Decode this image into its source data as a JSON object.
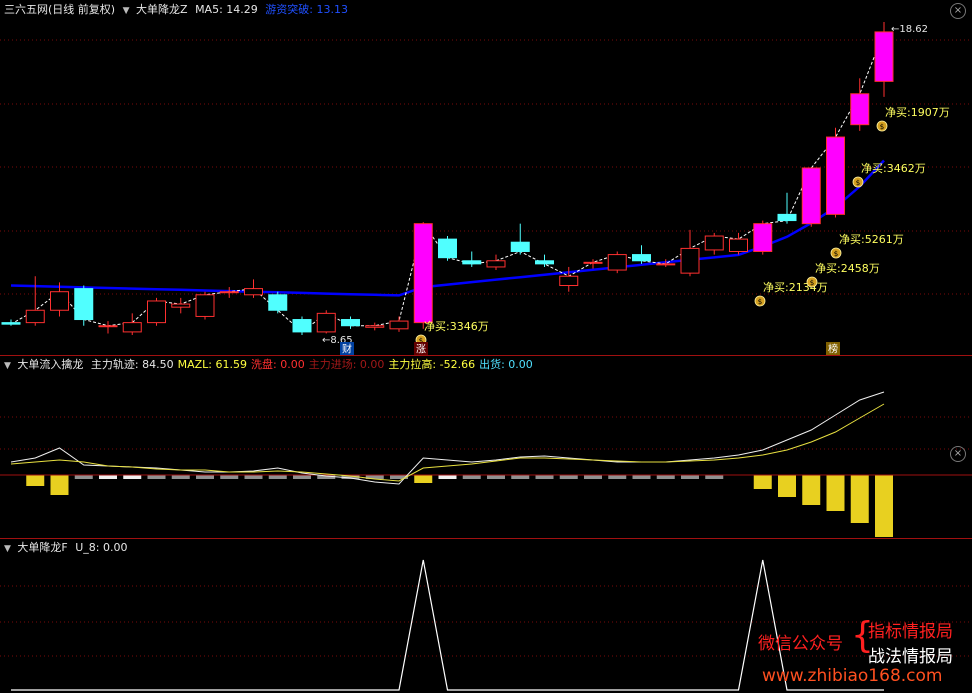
{
  "pane1": {
    "title": "三六五网(日线 前复权)",
    "indicator": "大单降龙Z",
    "ma5_label": "MA5: 14.29",
    "breakout_label": "游资突破: 13.13"
  },
  "pane2": {
    "name": "大单流入擒龙",
    "items": [
      {
        "text": "主力轨迹: 84.50",
        "color": "#e6e6e6"
      },
      {
        "text": "MAZL: 61.59",
        "color": "#ffff40"
      },
      {
        "text": "洗盘: 0.00",
        "color": "#ff3030"
      },
      {
        "text": "主力进场: 0.00",
        "color": "#a01818"
      },
      {
        "text": "主力拉高: -52.66",
        "color": "#ffff40"
      },
      {
        "text": "出货: 0.00",
        "color": "#50e0ff"
      }
    ]
  },
  "pane3": {
    "name": "大单降龙F",
    "value_label": "U_8: 0.00"
  },
  "annotations": {
    "high": "18.62",
    "low": "8.65",
    "tag_cai": "财",
    "tag_zhang": "涨",
    "tag_bang": "榜"
  },
  "net_buy_labels": [
    "净买:3346万",
    "净买:2134万",
    "净买:2458万",
    "净买:5261万",
    "净买:3462万",
    "净买:1907万"
  ],
  "watermark": {
    "wechat": "微信公众号",
    "line1": "指标情报局",
    "line2": "战法情报局",
    "url": "www.zhibiao168.com"
  },
  "colors": {
    "up": "#ff3030",
    "down": "#50ffff",
    "big_up": "#ff00ff",
    "ma": "#0000ff",
    "gold": "#e8d020"
  },
  "chart_data": {
    "type": "candlestick",
    "candles": [
      {
        "o": 8.9,
        "c": 8.85,
        "h": 9.0,
        "l": 8.8
      },
      {
        "o": 8.9,
        "c": 9.3,
        "h": 10.4,
        "l": 8.8
      },
      {
        "o": 9.3,
        "c": 9.9,
        "h": 10.2,
        "l": 9.1
      },
      {
        "o": 10.0,
        "c": 9.0,
        "h": 10.1,
        "l": 8.8
      },
      {
        "o": 8.8,
        "c": 8.8,
        "h": 8.95,
        "l": 8.55
      },
      {
        "o": 8.6,
        "c": 8.9,
        "h": 9.2,
        "l": 8.5
      },
      {
        "o": 8.9,
        "c": 9.6,
        "h": 9.7,
        "l": 8.8
      },
      {
        "o": 9.4,
        "c": 9.5,
        "h": 9.7,
        "l": 9.2
      },
      {
        "o": 9.1,
        "c": 9.8,
        "h": 9.9,
        "l": 9.0
      },
      {
        "o": 9.9,
        "c": 9.9,
        "h": 10.05,
        "l": 9.7
      },
      {
        "o": 9.8,
        "c": 10.0,
        "h": 10.3,
        "l": 9.7
      },
      {
        "o": 9.8,
        "c": 9.3,
        "h": 9.9,
        "l": 9.2
      },
      {
        "o": 9.0,
        "c": 8.6,
        "h": 9.1,
        "l": 8.5
      },
      {
        "o": 8.6,
        "c": 9.2,
        "h": 9.3,
        "l": 8.55
      },
      {
        "o": 9.0,
        "c": 8.8,
        "h": 9.1,
        "l": 8.7
      },
      {
        "o": 8.75,
        "c": 8.8,
        "h": 8.9,
        "l": 8.65
      },
      {
        "o": 8.7,
        "c": 8.95,
        "h": 9.1,
        "l": 8.6
      },
      {
        "o": 8.9,
        "c": 12.1,
        "h": 12.15,
        "l": 8.7
      },
      {
        "o": 11.6,
        "c": 11.0,
        "h": 11.7,
        "l": 10.9
      },
      {
        "o": 10.9,
        "c": 10.8,
        "h": 11.2,
        "l": 10.7
      },
      {
        "o": 10.7,
        "c": 10.9,
        "h": 11.1,
        "l": 10.6
      },
      {
        "o": 11.5,
        "c": 11.2,
        "h": 12.1,
        "l": 11.1
      },
      {
        "o": 10.9,
        "c": 10.8,
        "h": 11.1,
        "l": 10.7
      },
      {
        "o": 10.1,
        "c": 10.4,
        "h": 10.7,
        "l": 9.9
      },
      {
        "o": 10.85,
        "c": 10.85,
        "h": 10.95,
        "l": 10.65
      },
      {
        "o": 10.6,
        "c": 11.1,
        "h": 11.2,
        "l": 10.5
      },
      {
        "o": 11.1,
        "c": 10.9,
        "h": 11.4,
        "l": 10.8
      },
      {
        "o": 10.8,
        "c": 10.8,
        "h": 10.95,
        "l": 10.7
      },
      {
        "o": 10.5,
        "c": 11.3,
        "h": 11.9,
        "l": 10.4
      },
      {
        "o": 11.25,
        "c": 11.7,
        "h": 11.8,
        "l": 11.1
      },
      {
        "o": 11.2,
        "c": 11.6,
        "h": 11.8,
        "l": 11.1
      },
      {
        "o": 11.2,
        "c": 12.1,
        "h": 12.2,
        "l": 11.1
      },
      {
        "o": 12.4,
        "c": 12.2,
        "h": 13.1,
        "l": 12.1
      },
      {
        "o": 12.1,
        "c": 13.9,
        "h": 13.9,
        "l": 12.0
      },
      {
        "o": 12.4,
        "c": 14.9,
        "h": 15.2,
        "l": 12.3
      },
      {
        "o": 15.3,
        "c": 16.3,
        "h": 16.8,
        "l": 15.1
      },
      {
        "o": 16.7,
        "c": 18.3,
        "h": 18.62,
        "l": 16.2
      }
    ]
  }
}
